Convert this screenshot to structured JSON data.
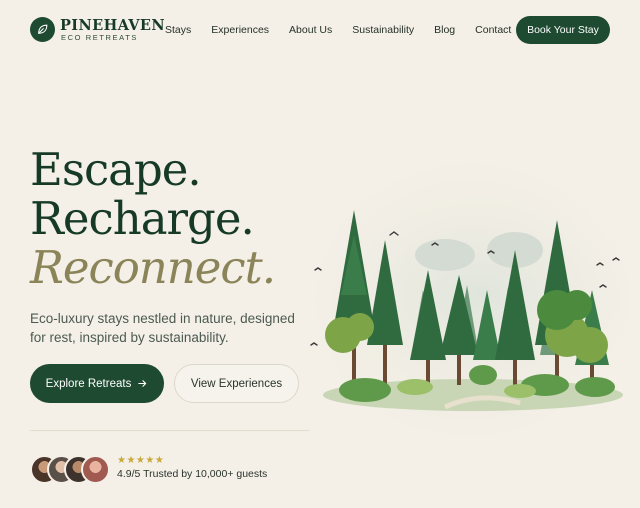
{
  "brand": {
    "name": "PINEHAVEN",
    "tagline": "ECO RETREATS",
    "icon": "leaf-icon"
  },
  "nav": {
    "links": [
      {
        "label": "Stays"
      },
      {
        "label": "Experiences"
      },
      {
        "label": "About Us"
      },
      {
        "label": "Sustainability"
      },
      {
        "label": "Blog"
      },
      {
        "label": "Contact"
      }
    ],
    "cta_label": "Book Your Stay"
  },
  "hero": {
    "headline_1": "Escape.",
    "headline_2": "Recharge.",
    "headline_3": "Reconnect.",
    "subtitle": "Eco-luxury stays nestled in nature, designed for rest, inspired by sustainability.",
    "primary_label": "Explore Retreats",
    "primary_icon": "arrow-right-icon",
    "secondary_label": "View Experiences"
  },
  "social_proof": {
    "stars": "★★★★★",
    "rating": 4.9,
    "rating_max": 5,
    "trust_text": "4.9/5 Trusted by 10,000+ guests",
    "avatar_count": 4
  },
  "colors": {
    "background": "#f4f0e8",
    "primary": "#1d4a30",
    "accent_olive": "#8a8458",
    "star": "#c7a93c"
  }
}
